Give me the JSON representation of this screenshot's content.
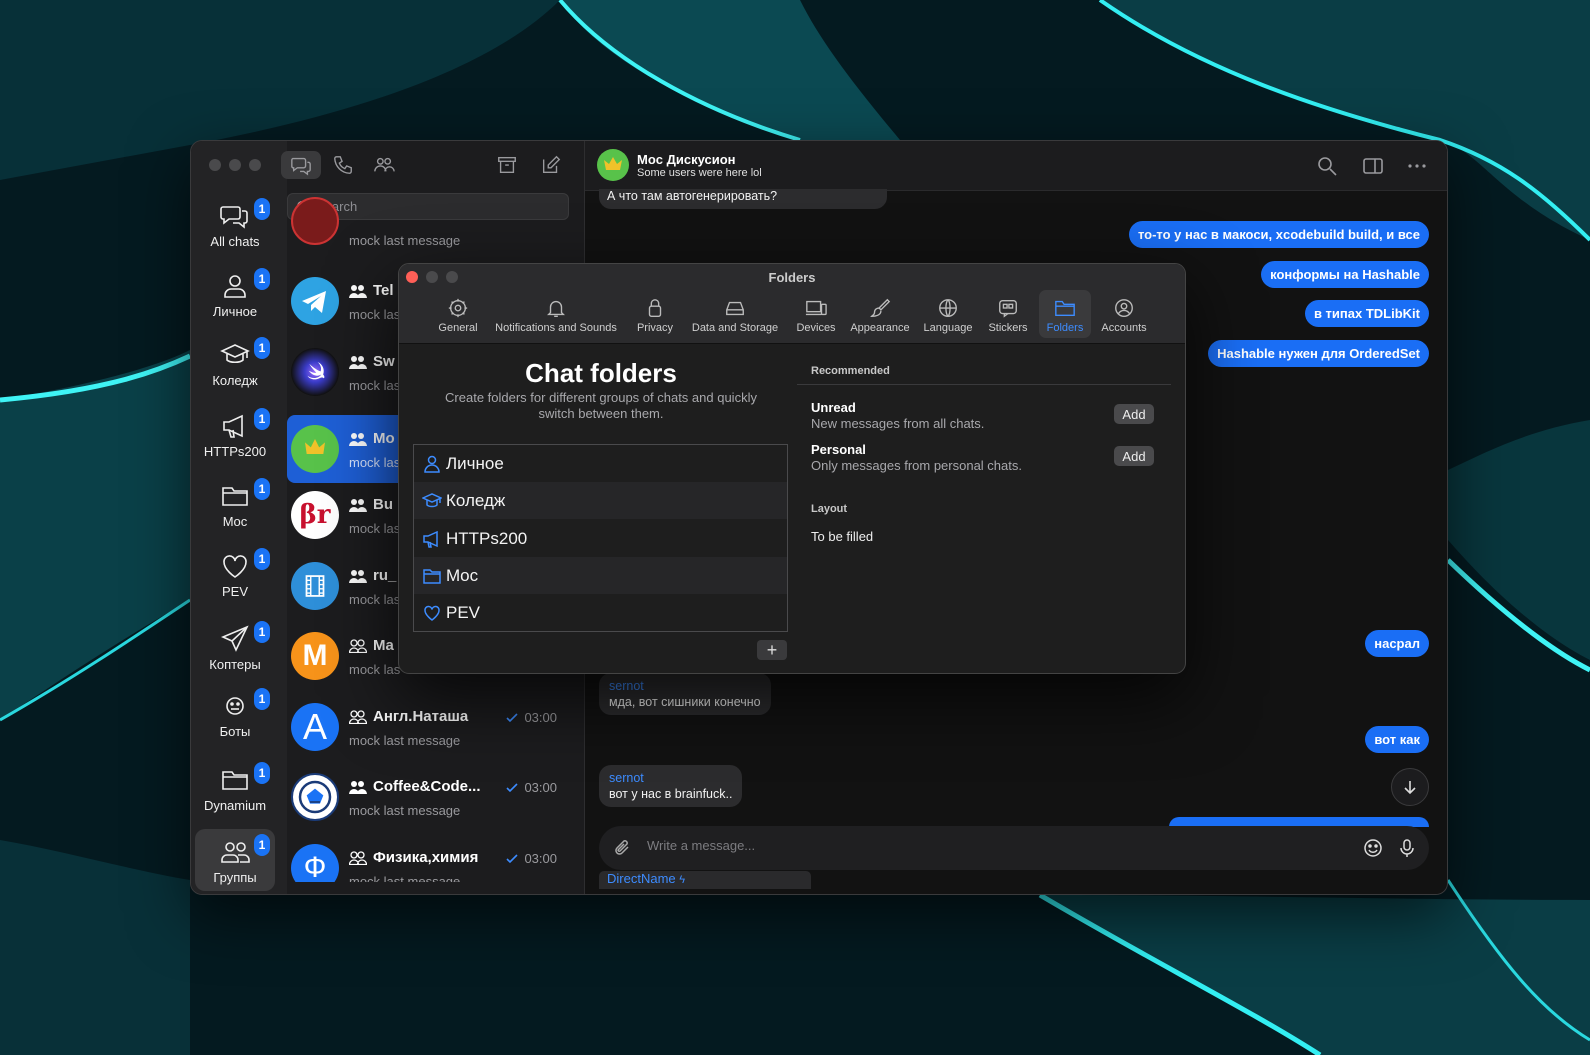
{
  "rail": {
    "items": [
      {
        "label": "All chats",
        "badge": "1",
        "icon": "chats-icon"
      },
      {
        "label": "Личное",
        "badge": "1",
        "icon": "person-icon"
      },
      {
        "label": "Коледж",
        "badge": "1",
        "icon": "graduation-cap-icon"
      },
      {
        "label": "HTTPs200",
        "badge": "1",
        "icon": "megaphone-icon"
      },
      {
        "label": "Moc",
        "badge": "1",
        "icon": "folder-icon"
      },
      {
        "label": "PEV",
        "badge": "1",
        "icon": "heart-icon"
      },
      {
        "label": "Коптеры",
        "badge": "1",
        "icon": "paper-plane-icon"
      },
      {
        "label": "Боты",
        "badge": "1",
        "icon": "bot-icon"
      },
      {
        "label": "Dynamium",
        "badge": "1",
        "icon": "folder-icon"
      },
      {
        "label": "Группы",
        "badge": "1",
        "icon": "group-icon"
      }
    ]
  },
  "chatlist": {
    "search_placeholder": "Search",
    "chats": [
      {
        "title": "",
        "last": "mock last message",
        "time": "",
        "avatar_bg": "#7a1b1b",
        "avatar_text": ""
      },
      {
        "title": "Tel",
        "last": "mock las",
        "time": "",
        "avatar_bg": "#2ea3e3",
        "avatar_text": "telegram"
      },
      {
        "title": "Sw",
        "last": "mock las",
        "time": "",
        "avatar_bg": "#1d1b3a",
        "avatar_text": ""
      },
      {
        "title": "Mo",
        "last": "mock las",
        "time": "",
        "avatar_bg": "#58c24a",
        "avatar_text": ""
      },
      {
        "title": "Bu",
        "last": "mock las",
        "time": "",
        "avatar_bg": "#ffffff",
        "avatar_text": "βr"
      },
      {
        "title": "ru_",
        "last": "mock las",
        "time": "",
        "avatar_bg": "#2e8fd9",
        "avatar_text": ""
      },
      {
        "title": "Ma",
        "last": "mock las",
        "time": "",
        "avatar_bg": "#f7931a",
        "avatar_text": "M"
      },
      {
        "title": "Англ.Наташа",
        "last": "mock last message",
        "time": "03:00",
        "avatar_bg": "#1a73f5",
        "avatar_text": "A"
      },
      {
        "title": "Coffee&Code...",
        "last": "mock last message",
        "time": "03:00",
        "avatar_bg": "#ffffff",
        "avatar_text": ""
      },
      {
        "title": "Физика,химия",
        "last": "mock last message",
        "time": "03:00",
        "avatar_bg": "#1a73f5",
        "avatar_text": "Ф"
      }
    ]
  },
  "conversation": {
    "title": "Moc Дискусион",
    "subtitle": "Some users were here lol",
    "messages_out": [
      "то-то у нас в макоси, xcodebuild build, и все",
      "конформы на Hashable",
      "в типах TDLibKit",
      "Hashable нужен для OrderedSet",
      "насрал",
      "вот как"
    ],
    "messages_in": [
      {
        "sender": "",
        "text": "А что там автогенерировать?"
      },
      {
        "sender": "sernot",
        "text": "мда, вот сишники конечно"
      },
      {
        "sender": "sernot",
        "text": "вот у нас в brainfuck.."
      }
    ],
    "composer_placeholder": "Write a message...",
    "direct_name": "DirectName"
  },
  "settings": {
    "window_title": "Folders",
    "tabs": [
      {
        "label": "General",
        "icon": "gear-icon"
      },
      {
        "label": "Notifications and Sounds",
        "icon": "bell-icon"
      },
      {
        "label": "Privacy",
        "icon": "lock-icon"
      },
      {
        "label": "Data and Storage",
        "icon": "drive-icon"
      },
      {
        "label": "Devices",
        "icon": "devices-icon"
      },
      {
        "label": "Appearance",
        "icon": "brush-icon"
      },
      {
        "label": "Language",
        "icon": "globe-icon"
      },
      {
        "label": "Stickers",
        "icon": "sticker-icon"
      },
      {
        "label": "Folders",
        "icon": "folder-icon"
      },
      {
        "label": "Accounts",
        "icon": "account-icon"
      }
    ],
    "heading": "Chat folders",
    "description": "Create folders for different groups of chats and quickly switch between them.",
    "folders": [
      {
        "name": "Личное",
        "icon": "person-icon"
      },
      {
        "name": "Коледж",
        "icon": "graduation-cap-icon"
      },
      {
        "name": "HTTPs200",
        "icon": "megaphone-icon"
      },
      {
        "name": "Moc",
        "icon": "folder-icon"
      },
      {
        "name": "PEV",
        "icon": "heart-icon"
      }
    ],
    "add_folder_label": "+",
    "recommended_heading": "Recommended",
    "recommended": [
      {
        "title": "Unread",
        "desc": "New messages from all chats.",
        "button": "Add"
      },
      {
        "title": "Personal",
        "desc": "Only messages from personal chats.",
        "button": "Add"
      }
    ],
    "layout_heading": "Layout",
    "layout_value": "To be filled"
  },
  "colors": {
    "accent": "#1a73f5",
    "wallpaper_glow": "#2de3e8"
  }
}
